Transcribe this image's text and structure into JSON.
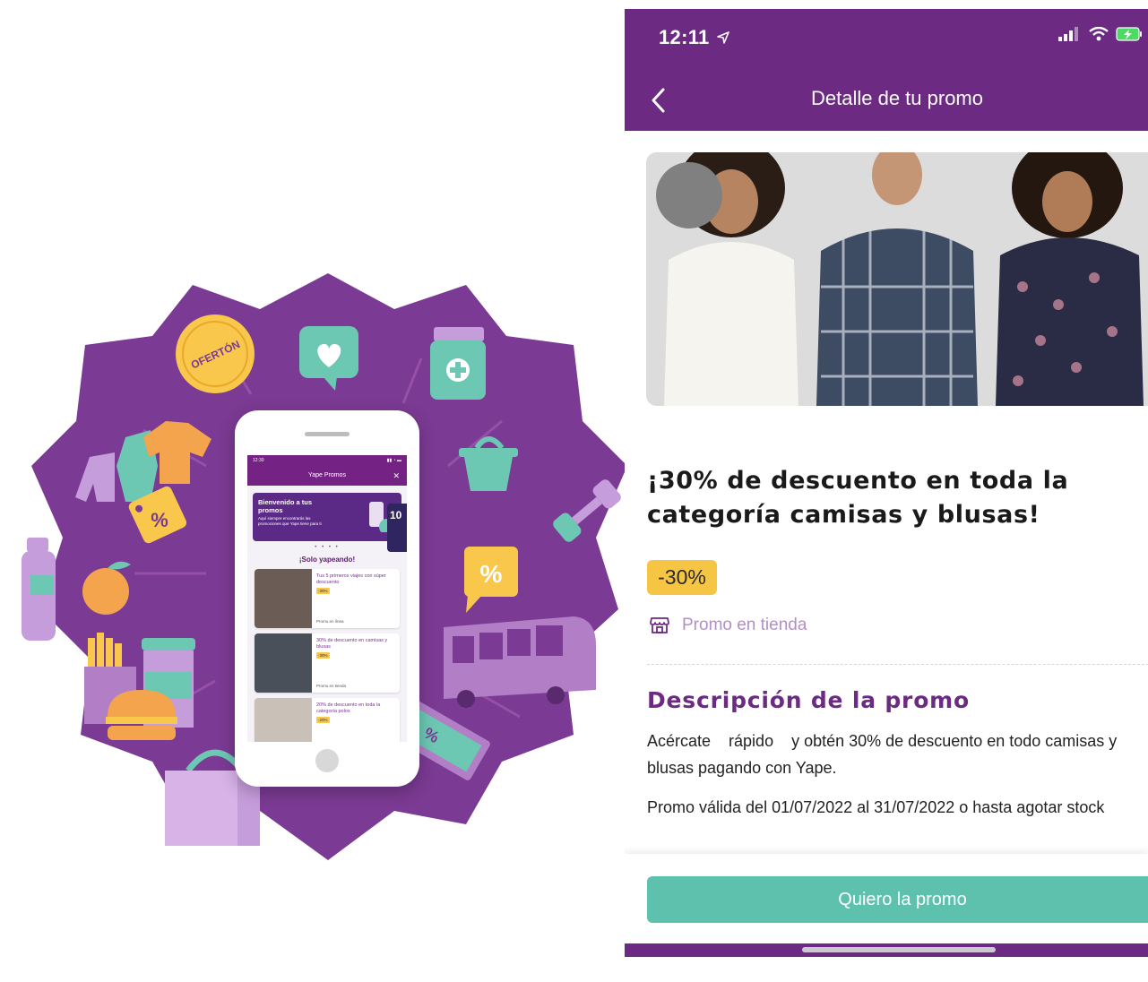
{
  "illustration": {
    "ofertón_sticker": "OFERTÓN",
    "percent_sign_tag": "%",
    "percent_sign_bubble": "%",
    "mini_phone": {
      "status_time": "12:30",
      "header_title": "Yape Promos",
      "close_glyph": "✕",
      "welcome_title": "Bienvenido a tus promos",
      "welcome_subtitle": "Aquí siempre encontrarás las promociones que Yape tiene para ti",
      "side_card_text": "10",
      "carousel_dots": "• • • •",
      "section_title": "¡Solo yapeando!",
      "cards": [
        {
          "text": "Tus 5 primeros viajes con súper descuento",
          "tag": "-30%",
          "location": "Promo en línea"
        },
        {
          "text": "30% de descuento en camisas y blusas",
          "tag": "-30%",
          "location": "Promo en tienda"
        },
        {
          "text": "20% de descuento en toda la categoría polos",
          "tag": "-20%",
          "location": ""
        }
      ]
    }
  },
  "phone": {
    "status": {
      "time": "12:11",
      "location_arrow_icon": "location-arrow-icon",
      "signal_icon": "signal-icon",
      "wifi_icon": "wifi-icon",
      "battery_icon": "battery-charging-icon"
    },
    "nav": {
      "back_icon": "chevron-left-icon",
      "title": "Detalle de tu promo"
    },
    "promo": {
      "title": "¡30% de descuento en toda la categoría camisas y blusas!",
      "discount": "-30%",
      "type_icon": "store-icon",
      "type_label": "Promo en tienda"
    },
    "description": {
      "heading": "Descripción de la promo",
      "body": "Acércate    rápido    y obtén 30% de descuento en todo camisas y blusas pagando con Yape.",
      "validity": "Promo válida del 01/07/2022 al 31/07/2022 o hasta agotar stock"
    },
    "cta": {
      "label": "Quiero la promo"
    },
    "colors": {
      "brand": "#6c2a82",
      "accent": "#5dc1ae",
      "badge": "#f6c544"
    }
  }
}
